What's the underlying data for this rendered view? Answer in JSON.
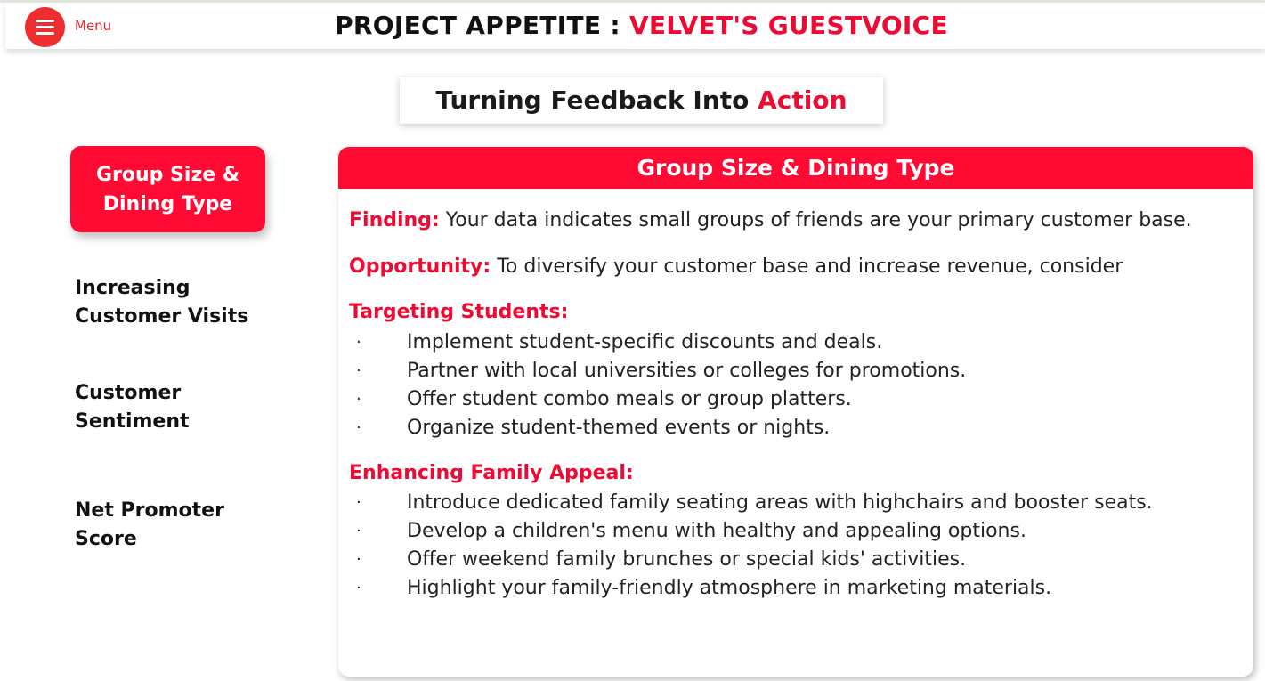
{
  "header": {
    "menu_label": "Menu",
    "title_prefix": "PROJECT APPETITE : ",
    "title_accent": "VELVET'S GUESTVOICE"
  },
  "subtitle": {
    "text": "Turning Feedback Into ",
    "accent": "Action"
  },
  "sidebar": {
    "active": "Group Size & Dining Type",
    "items": [
      {
        "line1": "Increasing",
        "line2": "Customer Visits"
      },
      {
        "line1": "Customer",
        "line2": "Sentiment"
      },
      {
        "line1": "Net Promoter",
        "line2": "Score"
      }
    ]
  },
  "panel": {
    "title": "Group Size & Dining Type",
    "finding_label": "Finding:",
    "finding_text": " Your data indicates small groups of friends are your primary customer base.",
    "opportunity_label": "Opportunity:",
    "opportunity_text": " To diversify your customer base and increase revenue, consider",
    "students_heading": "Targeting Students:",
    "students": [
      "Implement student-specific discounts and deals.",
      "Partner with local universities or colleges for promotions.",
      "Offer student combo meals or group platters.",
      "Organize student-themed events or nights."
    ],
    "family_heading": "Enhancing Family Appeal:",
    "family": [
      "Introduce dedicated family seating areas with highchairs and booster seats.",
      "Develop a children's menu with healthy and appealing options.",
      "Offer weekend family brunches or special kids' activities.",
      "Highlight your family-friendly atmosphere in marketing materials."
    ]
  },
  "colors": {
    "accent": "#ee0b33",
    "menu_button": "#ee2e2e"
  }
}
